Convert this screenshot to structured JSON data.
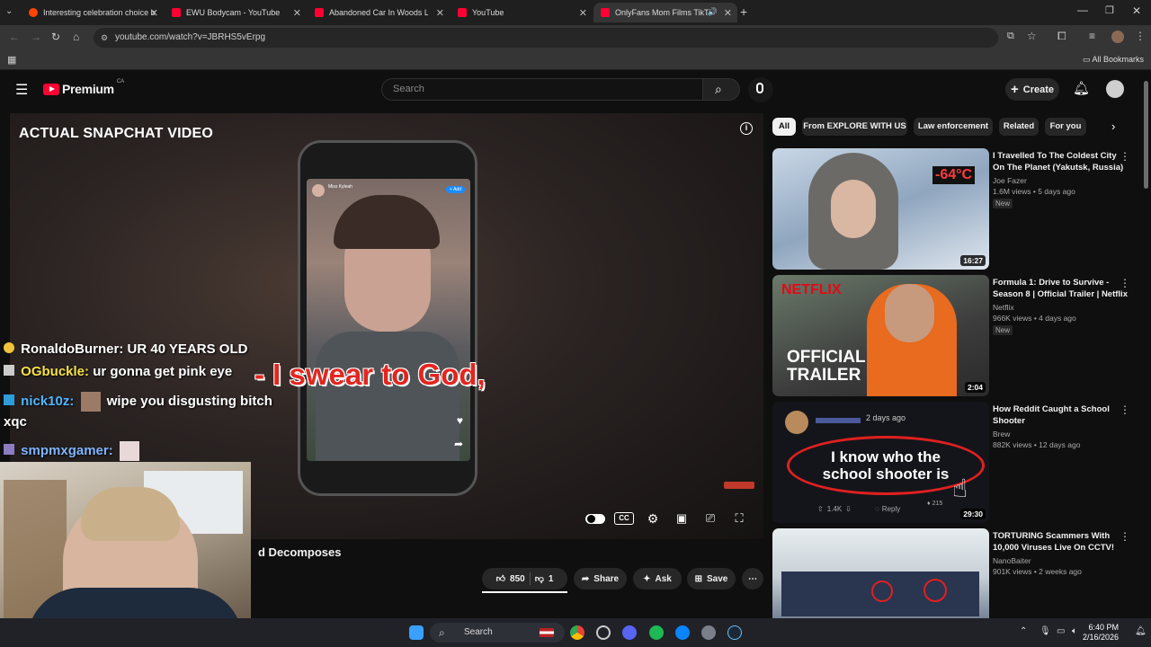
{
  "browser": {
    "tabs": [
      {
        "label": "Interesting celebration choice b",
        "active": false
      },
      {
        "label": "EWU Bodycam - YouTube",
        "active": false
      },
      {
        "label": "Abandoned Car In Woods Lead",
        "active": false
      },
      {
        "label": "YouTube",
        "active": false
      },
      {
        "label": "OnlyFans Mom Films TikTok",
        "active": true
      }
    ],
    "url": "youtube.com/watch?v=JBRHS5vErpg",
    "bookmarks_label": "All Bookmarks"
  },
  "youtube": {
    "logo": "Premium",
    "region": "CA",
    "search_placeholder": "Search",
    "create_label": "Create"
  },
  "player": {
    "overlay_title": "ACTUAL SNAPCHAT VIDEO",
    "caption": "- I swear to God,",
    "phone_user": "Miss Kyleah",
    "phone_add": "+ Add"
  },
  "chat": [
    {
      "user": "RonaldoBurner:",
      "message": "UR 40 YEARS OLD"
    },
    {
      "user": "OGbuckle:",
      "message": "ur gonna get pink eye"
    },
    {
      "user": "nick10z:",
      "message": "wipe you disgusting bitch"
    },
    {
      "user": "",
      "message": "xqc"
    },
    {
      "user": "smpmxgamer:",
      "message": ""
    }
  ],
  "video": {
    "title_fragment": "d Decomposes",
    "likes": "850",
    "dislikes": "1",
    "share_label": "Share",
    "ask_label": "Ask",
    "save_label": "Save"
  },
  "chips": [
    "All",
    "From EXPLORE WITH US",
    "Law enforcement",
    "Related",
    "For you"
  ],
  "recommendations": [
    {
      "title": "I Travelled To The Coldest City On The Planet (Yakutsk, Russia)",
      "channel": "Joe Fazer",
      "meta": "1.6M views • 5 days ago",
      "badge": "New",
      "duration": "16:27",
      "thumb_text": "-64°C"
    },
    {
      "title": "Formula 1: Drive to Survive - Season 8 | Official Trailer | Netflix",
      "channel": "Netflix",
      "meta": "966K views • 4 days ago",
      "badge": "New",
      "duration": "2:04",
      "thumb_text": "OFFICIAL TRAILER",
      "thumb_brand": "NETFLIX"
    },
    {
      "title": "How Reddit Caught a School Shooter",
      "channel": "Brew",
      "meta": "882K views • 12 days ago",
      "badge": "",
      "duration": "29:30",
      "thumb_text": "I know who the school shooter is",
      "thumb_time": "2 days ago",
      "thumb_votes": "1.4K",
      "thumb_reply": "Reply",
      "thumb_award": "215"
    },
    {
      "title": "TORTURING Scammers With 10,000 Viruses Live On CCTV!",
      "channel": "NanoBaiter",
      "meta": "901K views • 2 weeks ago",
      "badge": "",
      "duration": "",
      "thumb_text": ""
    }
  ],
  "taskbar": {
    "search_label": "Search",
    "time": "6:40 PM",
    "date": "2/16/2026"
  }
}
